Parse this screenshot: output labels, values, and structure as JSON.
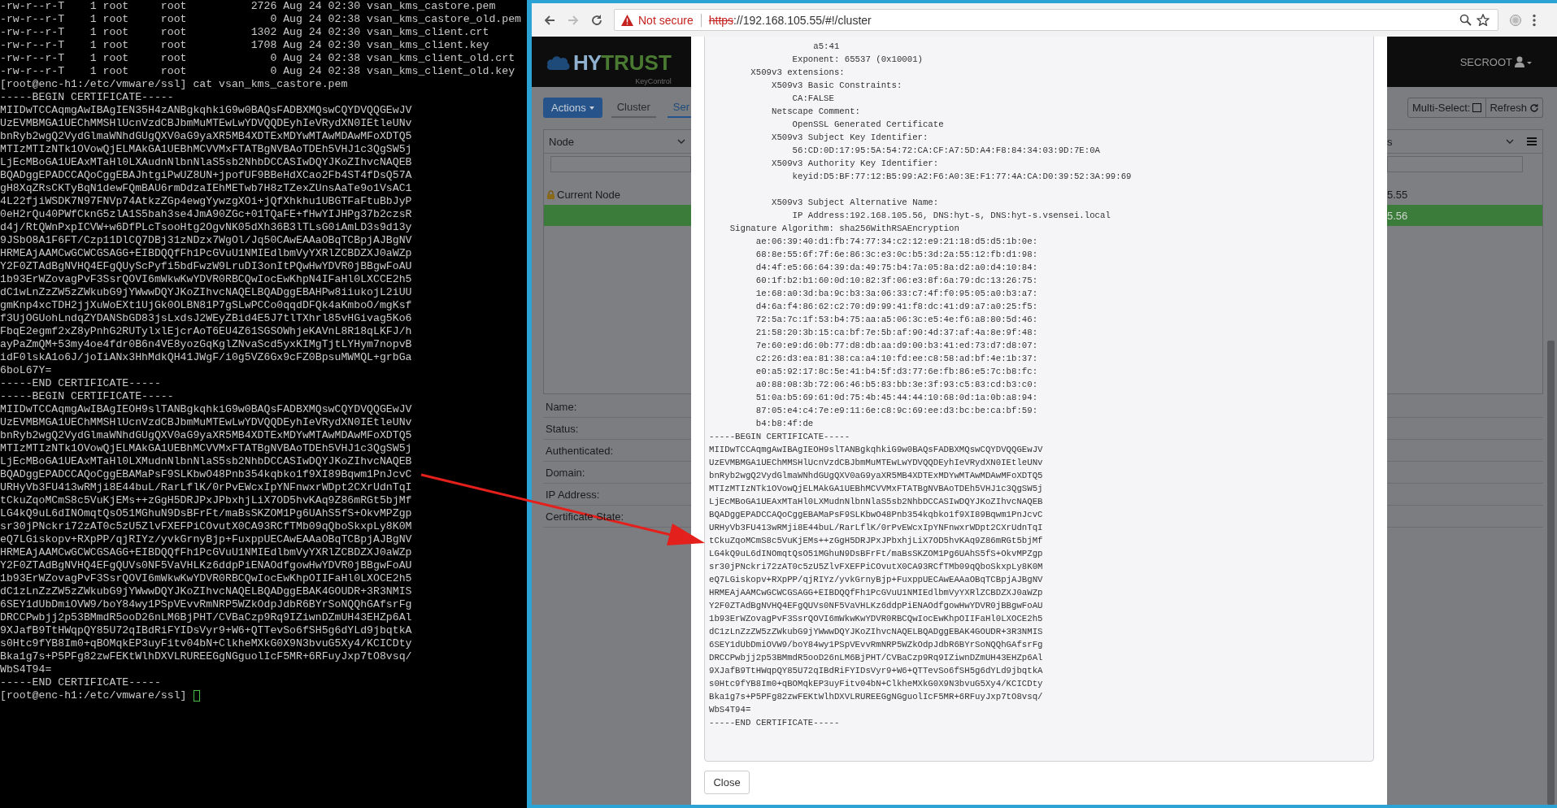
{
  "terminal": {
    "lines": [
      "-rw-r--r-T    1 root     root          2726 Aug 24 02:30 vsan_kms_castore.pem",
      "-rw-r--r-T    1 root     root             0 Aug 24 02:38 vsan_kms_castore_old.pem",
      "-rw-r--r-T    1 root     root          1302 Aug 24 02:30 vsan_kms_client.crt",
      "-rw-r--r-T    1 root     root          1708 Aug 24 02:30 vsan_kms_client.key",
      "-rw-r--r-T    1 root     root             0 Aug 24 02:38 vsan_kms_client_old.crt",
      "-rw-r--r-T    1 root     root             0 Aug 24 02:38 vsan_kms_client_old.key",
      "[root@enc-h1:/etc/vmware/ssl] cat vsan_kms_castore.pem",
      "-----BEGIN CERTIFICATE-----",
      "MIIDwTCCAqmgAwIBAgIEN35H4zANBgkqhkiG9w0BAQsFADBXMQswCQYDVQQGEwJV",
      "UzEVMBMGA1UEChMMSHlUcnVzdCBJbmMuMTEwLwYDVQQDEyhIeVRydXN0IEtleUNv",
      "bnRyb2wgQ2VydGlmaWNhdGUgQXV0aG9yaXR5MB4XDTExMDYwMTAwMDAwMFoXDTQ5",
      "MTIzMTIzNTk1OVowQjELMAkGA1UEBhMCVVMxFTATBgNVBAoTDEh5VHJ1c3QgSW5j",
      "LjEcMBoGA1UEAxMTaHl0LXAudnNlbnNlaS5sb2NhbDCCASIwDQYJKoZIhvcNAQEB",
      "BQADggEPADCCAQoCggEBAJhtgiPwUZ8UN+jpofUF9BBeHdXCao2Fb4ST4fDsQ57A",
      "gH8XqZRsCKTyBqN1dewFQmBAU6rmDdzaIEhMETwb7H8zTZexZUnsAaTe9o1VsAC1",
      "4L22fjiWSDK7N97FNVp74AtkzZGp4ewgYywzgXOi+jQfXhkhu1UBGTFaFtuBbJyP",
      "0eH2rQu40PWfCknG5zlA1S5bah3se4JmA90ZGc+01TQaFE+fHwYIJHPg37b2czsR",
      "d4j/RtQWnPxpICVW+w6DfPLcTsooHtg2OgvNK05dXh36B3lTLsG0iAmLD3s9d13y",
      "9JSbO8A1F6FT/Czp11DlCQ7DBj31zNDzx7WgOl/Jq50CAwEAAaOBqTCBpjAJBgNV",
      "HRMEAjAAMCwGCWCGSAGG+EIBDQQfFh1PcGVuU1NMIEdlbmVyYXRlZCBDZXJ0aWZp",
      "Y2F0ZTAdBgNVHQ4EFgQUyScPyfi5bdFwzW9LruDI3onItPQwHwYDVR0jBBgwFoAU",
      "1b93ErWZovagPvF3SsrQOVI6mWkwKwYDVR0RBCQwIocEwKhpN4IFaHl0LXCCE2h5",
      "dC1wLnZzZW5zZWkubG9jYWwwDQYJKoZIhvcNAQELBQADggEBAHPw8iiukojL2iUU",
      "gmKnp4xcTDH2jjXuWoEXt1UjGk0OLBN81P7gSLwPCCo0qqdDFQk4aKmboO/mgKsf",
      "f3UjOGUohLndqZYDANSbGD83jsLxdsJ2WEyZBid4E5J7tlTXhrl85vHGivag5Ko6",
      "FbqE2egmf2xZ8yPnhG2RUTylxlEjcrAoT6EU4Z61SGSOWhjeKAVnL8R18qLKFJ/h",
      "ayPaZmQM+53my4oe4fdr0B6n4VE8yozGqKglZNvaScd5yxKIMgTjtLYHym7nopvB",
      "idF0lskA1o6J/joIiANx3HhMdkQH41JWgF/i0g5VZ6Gx9cFZ0BpsuMWMQL+grbGa",
      "6boL67Y=",
      "-----END CERTIFICATE-----",
      "-----BEGIN CERTIFICATE-----",
      "MIIDwTCCAqmgAwIBAgIEOH9slTANBgkqhkiG9w0BAQsFADBXMQswCQYDVQQGEwJV",
      "UzEVMBMGA1UEChMMSHlUcnVzdCBJbmMuMTEwLwYDVQQDEyhIeVRydXN0IEtleUNv",
      "bnRyb2wgQ2VydGlmaWNhdGUgQXV0aG9yaXR5MB4XDTExMDYwMTAwMDAwMFoXDTQ5",
      "MTIzMTIzNTk1OVowQjELMAkGA1UEBhMCVVMxFTATBgNVBAoTDEh5VHJ1c3QgSW5j",
      "LjEcMBoGA1UEAxMTaHl0LXMudnNlbnNlaS5sb2NhbDCCASIwDQYJKoZIhvcNAQEB",
      "BQADggEPADCCAQoCggEBAMaPsF9SLKbwO48Pnb354kqbko1f9XI89Bqwm1PnJcvC",
      "URHyVb3FU413wRMji8E44buL/RarLflK/0rPvEWcxIpYNFnwxrWDpt2CXrUdnTqI",
      "tCkuZqoMCmS8c5VuKjEMs++zGgH5DRJPxJPbxhjLiX7OD5hvKAq9Z86mRGt5bjMf",
      "LG4kQ9uL6dINOmqtQsO51MGhuN9DsBFrFt/maBsSKZOM1Pg6UAhS5fS+OkvMPZgp",
      "sr30jPNckri72zAT0c5zU5ZlvFXEFPiCOvutX0CA93RCfTMb09qQboSkxpLy8K0M",
      "eQ7LGiskopv+RXpPP/qjRIYz/yvkGrnyBjp+FuxppUECAwEAAaOBqTCBpjAJBgNV",
      "HRMEAjAAMCwGCWCGSAGG+EIBDQQfFh1PcGVuU1NMIEdlbmVyYXRlZCBDZXJ0aWZp",
      "Y2F0ZTAdBgNVHQ4EFgQUVs0NF5VaVHLKz6ddpPiENAOdfgowHwYDVR0jBBgwFoAU",
      "1b93ErWZovagPvF3SsrQOVI6mWkwKwYDVR0RBCQwIocEwKhpOIIFaHl0LXOCE2h5",
      "dC1zLnZzZW5zZWkubG9jYWwwDQYJKoZIhvcNAQELBQADggEBAK4GOUDR+3R3NMIS",
      "6SEY1dUbDmiOVW9/boY84wy1PSpVEvvRmNRP5WZkOdpJdbR6BYrSoNQQhGAfsrFg",
      "DRCCPwbjj2p53BMmdR5ooD26nLM6BjPHT/CVBaCzp9Rq9IZiwnDZmUH43EHZp6Al",
      "9XJafB9TtHWqpQY85U72qIBdRiFYIDsVyr9+W6+QTTevSo6fSH5g6dYLd9jbqtkA",
      "s0Htc9fYB8Im0+qBOMqkEP3uyFitv04bN+ClkheMXkG0X9N3bvuG5Xy4/KCICDty",
      "Bka1g7s+P5PFg82zwFEKtWlhDXVLRUREEGgNGguolIcF5MR+6RFuyJxp7tO8vsq/",
      "WbS4T94=",
      "-----END CERTIFICATE-----"
    ],
    "prompt": "[root@enc-h1:/etc/vmware/ssl]"
  },
  "browser": {
    "security_label": "Not secure",
    "url_scheme": "https",
    "url_rest": "://192.168.105.55/#!/cluster"
  },
  "app": {
    "logo": {
      "mark": "HY",
      "name": "TRUST",
      "subtitle": "KeyControl"
    },
    "user": "SECROOT",
    "actions_button": "Actions",
    "tabs": [
      {
        "label": "Cluster",
        "selected": false
      },
      {
        "label": "Ser",
        "selected": true
      }
    ],
    "multi_select": {
      "label": "Multi-Select:",
      "checked": false
    },
    "refresh_button": "Refresh",
    "node_table": {
      "column_1": "Node",
      "column_2": "s",
      "rows": [
        {
          "selected": false,
          "locked": true,
          "node": "Current Node",
          "column_2": "5.55"
        },
        {
          "selected": true,
          "locked": false,
          "column_2": "5.56"
        }
      ]
    },
    "details": [
      "Name:",
      "Status:",
      "Authenticated:",
      "Domain:",
      "IP Address:",
      "Certificate State:"
    ]
  },
  "modal": {
    "blocks": [
      [
        "                    a5:41",
        "                Exponent: 65537 (0x10001)",
        "        X509v3 extensions:",
        "            X509v3 Basic Constraints:",
        "                CA:FALSE",
        "            Netscape Comment:",
        "                OpenSSL Generated Certificate",
        "            X509v3 Subject Key Identifier:",
        "                56:CD:0D:17:95:5A:54:72:CA:CF:A7:5D:A4:F8:84:34:03:9D:7E:0A",
        "            X509v3 Authority Key Identifier:",
        "                keyid:D5:BF:77:12:B5:99:A2:F6:A0:3E:F1:77:4A:CA:D0:39:52:3A:99:69"
      ],
      [
        "            X509v3 Subject Alternative Name:",
        "                IP Address:192.168.105.56, DNS:hyt-s, DNS:hyt-s.vsensei.local",
        "    Signature Algorithm: sha256WithRSAEncryption",
        "         ae:06:39:40:d1:fb:74:77:34:c2:12:e9:21:18:d5:d5:1b:0e:",
        "         68:8e:55:6f:7f:6e:86:3c:e3:0c:b5:3d:2a:55:12:fb:d1:98:",
        "         d4:4f:e5:66:64:39:da:49:75:b4:7a:05:8a:d2:a0:d4:10:84:",
        "         60:1f:b2:b1:60:0d:10:82:3f:06:e3:8f:6a:79:dc:13:26:75:",
        "         1e:68:a0:3d:ba:9c:b3:3a:06:33:c7:4f:f0:95:05:a0:b3:a7:",
        "         d4:6a:f4:86:62:c2:70:d9:99:41:f8:dc:41:d9:a7:a0:25:f5:",
        "         72:5a:7c:1f:53:b4:75:aa:a5:06:3c:e5:4e:f6:a8:80:5d:46:",
        "         21:58:20:3b:15:ca:bf:7e:5b:af:90:4d:37:af:4a:8e:9f:48:",
        "         7e:60:e9:d6:0b:77:d8:db:aa:d9:00:b3:41:ed:73:d7:d8:07:",
        "         c2:26:d3:ea:81:38:ca:a4:10:fd:ee:c8:58:ad:bf:4e:1b:37:",
        "         e0:a5:92:17:8c:5e:41:b4:5f:d3:77:6e:fb:86:e5:7c:b8:fc:",
        "         a0:88:08:3b:72:06:46:b5:83:bb:3e:3f:93:c5:83:cd:b3:c0:",
        "         51:0a:b5:69:61:0d:75:4b:45:44:44:10:68:0d:1a:0b:a8:94:",
        "         87:05:e4:c4:7e:e9:11:6e:c8:9c:69:ee:d3:bc:be:ca:bf:59:",
        "         b4:b8:4f:de",
        "-----BEGIN CERTIFICATE-----",
        "MIIDwTCCAqmgAwIBAgIEOH9slTANBgkqhkiG9w0BAQsFADBXMQswCQYDVQQGEwJV",
        "UzEVMBMGA1UEChMMSHlUcnVzdCBJbmMuMTEwLwYDVQQDEyhIeVRydXN0IEtleUNv",
        "bnRyb2wgQ2VydGlmaWNhdGUgQXV0aG9yaXR5MB4XDTExMDYwMTAwMDAwMFoXDTQ5",
        "MTIzMTIzNTk1OVowQjELMAkGA1UEBhMCVVMxFTATBgNVBAoTDEh5VHJ1c3QgSW5j",
        "LjEcMBoGA1UEAxMTaHl0LXMudnNlbnNlaS5sb2NhbDCCASIwDQYJKoZIhvcNAQEB",
        "BQADggEPADCCAQoCggEBAMaPsF9SLKbwO48Pnb354kqbko1f9XI89Bqwm1PnJcvC",
        "URHyVb3FU413wRMji8E44buL/RarLflK/0rPvEWcxIpYNFnwxrWDpt2CXrUdnTqI",
        "tCkuZqoMCmS8c5VuKjEMs++zGgH5DRJPxJPbxhjLiX7OD5hvKAq9Z86mRGt5bjMf",
        "LG4kQ9uL6dINOmqtQsO51MGhuN9DsBFrFt/maBsSKZOM1Pg6UAhS5fS+OkvMPZgp",
        "sr30jPNckri72zAT0c5zU5ZlvFXEFPiCOvutX0CA93RCfTMb09qQboSkxpLy8K0M",
        "eQ7LGiskopv+RXpPP/qjRIYz/yvkGrnyBjp+FuxppUECAwEAAaOBqTCBpjAJBgNV",
        "HRMEAjAAMCwGCWCGSAGG+EIBDQQfFh1PcGVuU1NMIEdlbmVyYXRlZCBDZXJ0aWZp",
        "Y2F0ZTAdBgNVHQ4EFgQUVs0NF5VaVHLKz6ddpPiENAOdfgowHwYDVR0jBBgwFoAU",
        "1b93ErWZovagPvF3SsrQOVI6mWkwKwYDVR0RBCQwIocEwKhpOIIFaHl0LXOCE2h5",
        "dC1zLnZzZW5zZWkubG9jYWwwDQYJKoZIhvcNAQELBQADggEBAK4GOUDR+3R3NMIS",
        "6SEY1dUbDmiOVW9/boY84wy1PSpVEvvRmNRP5WZkOdpJdbR6BYrSoNQQhGAfsrFg",
        "DRCCPwbjj2p53BMmdR5ooD26nLM6BjPHT/CVBaCzp9Rq9IZiwnDZmUH43EHZp6Al",
        "9XJafB9TtHWqpQY85U72qIBdRiFYIDsVyr9+W6+QTTevSo6fSH5g6dYLd9jbqtkA",
        "s0Htc9fYB8Im0+qBOMqkEP3uyFitv04bN+ClkheMXkG0X9N3bvuG5Xy4/KCICDty",
        "Bka1g7s+P5PFg82zwFEKtWlhDXVLRUREEGgNGguolIcF5MR+6RFuyJxp7tO8vsq/",
        "WbS4T94=",
        "-----END CERTIFICATE-----"
      ]
    ],
    "close_button": "Close"
  }
}
